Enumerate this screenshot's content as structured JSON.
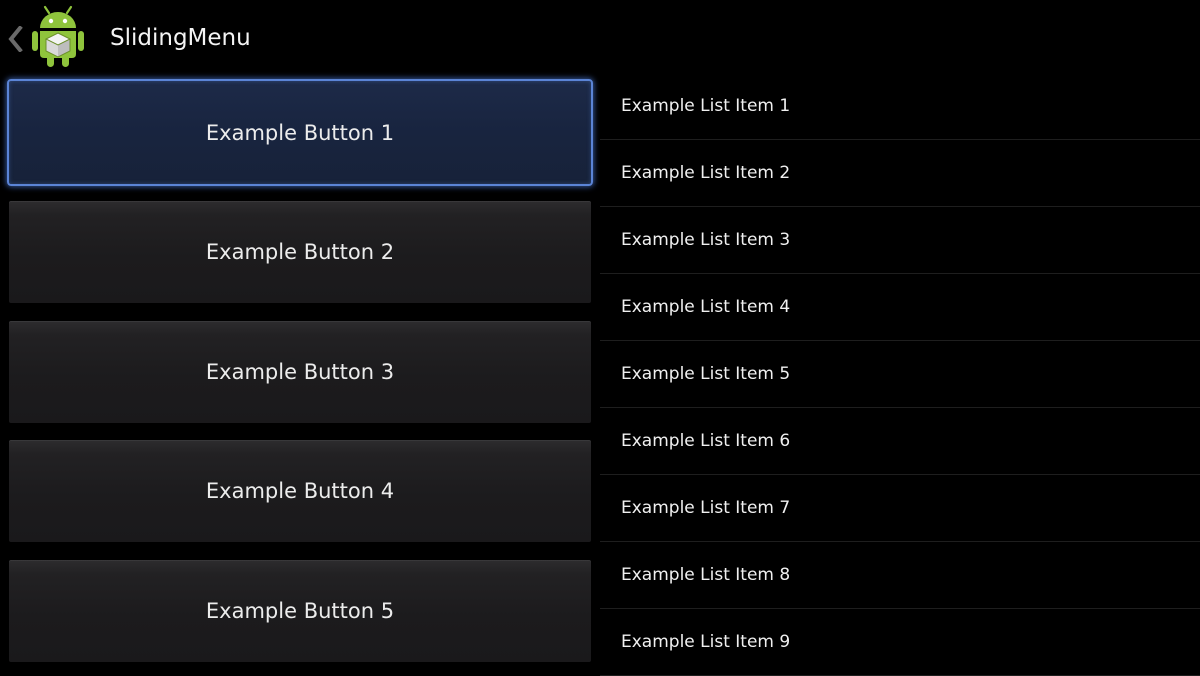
{
  "action_bar": {
    "title": "SlidingMenu",
    "up_icon": "chevron-left-icon",
    "app_icon": "android-robot-icon",
    "background": "#000000"
  },
  "menu": {
    "buttons": [
      {
        "label": "Example Button 1",
        "focused": true
      },
      {
        "label": "Example Button 2",
        "focused": false
      },
      {
        "label": "Example Button 3",
        "focused": false
      },
      {
        "label": "Example Button 4",
        "focused": false
      },
      {
        "label": "Example Button 5",
        "focused": false
      }
    ],
    "focus_color": "#5b84d6"
  },
  "list": {
    "items": [
      {
        "label": "Example List Item 1"
      },
      {
        "label": "Example List Item 2"
      },
      {
        "label": "Example List Item 3"
      },
      {
        "label": "Example List Item 4"
      },
      {
        "label": "Example List Item 5"
      },
      {
        "label": "Example List Item 6"
      },
      {
        "label": "Example List Item 7"
      },
      {
        "label": "Example List Item 8"
      },
      {
        "label": "Example List Item 9"
      }
    ]
  }
}
